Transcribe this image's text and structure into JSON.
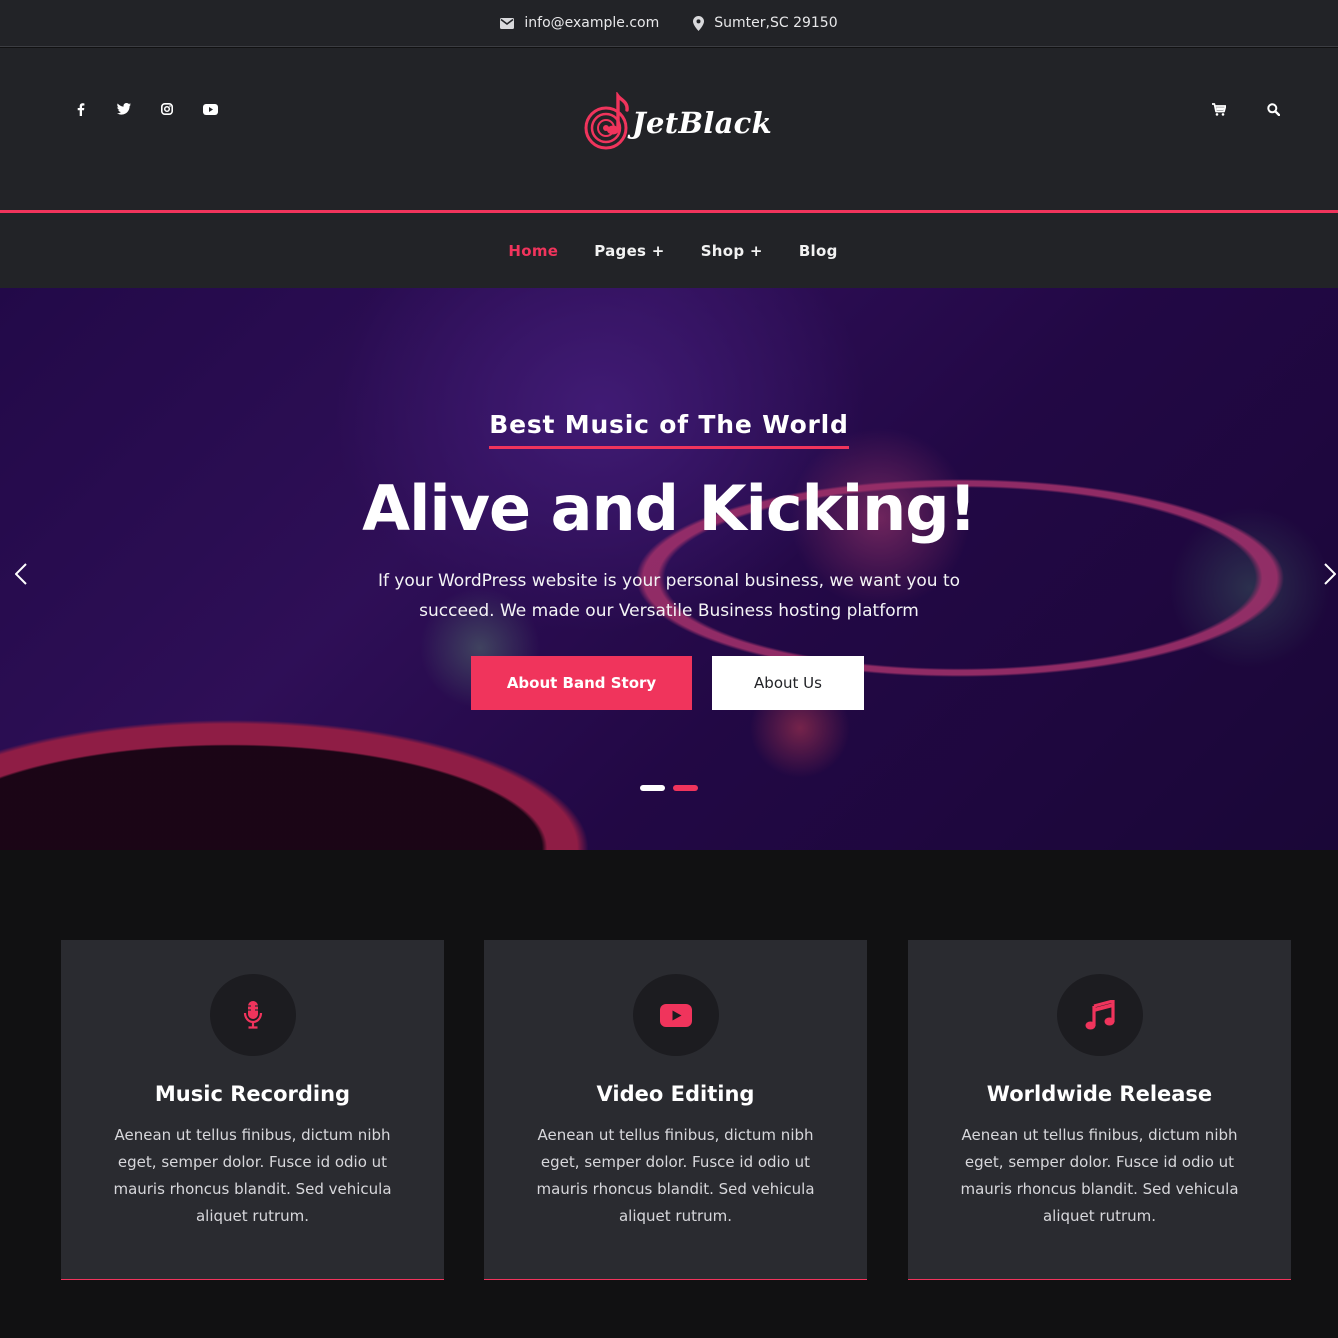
{
  "topbar": {
    "email": "info@example.com",
    "location": "Sumter,SC 29150"
  },
  "header": {
    "brand": "JetBlack",
    "social_icons": [
      "facebook-icon",
      "twitter-icon",
      "instagram-icon",
      "youtube-icon"
    ],
    "tool_icons": [
      "cart-icon",
      "search-icon"
    ]
  },
  "nav": {
    "items": [
      {
        "label": "Home",
        "active": true
      },
      {
        "label": "Pages +"
      },
      {
        "label": "Shop +"
      },
      {
        "label": "Blog"
      }
    ]
  },
  "hero": {
    "kicker": "Best Music of The World",
    "headline": "Alive and Kicking!",
    "subtext": "If your WordPress website is your personal business, we want you to succeed. We made our Versatile Business hosting platform",
    "primary_button": "About Band Story",
    "secondary_button": "About Us",
    "slides": 2,
    "active_slide": 1
  },
  "features": [
    {
      "icon": "microphone-icon",
      "title": "Music Recording",
      "text": "Aenean ut tellus finibus, dictum nibh eget, semper dolor. Fusce id odio ut mauris rhoncus blandit. Sed vehicula aliquet rutrum."
    },
    {
      "icon": "youtube-play-icon",
      "title": "Video Editing",
      "text": "Aenean ut tellus finibus, dictum nibh eget, semper dolor. Fusce id odio ut mauris rhoncus blandit. Sed vehicula aliquet rutrum."
    },
    {
      "icon": "music-note-icon",
      "title": "Worldwide Release",
      "text": "Aenean ut tellus finibus, dictum nibh eget, semper dolor. Fusce id odio ut mauris rhoncus blandit. Sed vehicula aliquet rutrum."
    }
  ],
  "colors": {
    "accent": "#f0345c",
    "header_bg": "#222327",
    "card_bg": "#2a2b30",
    "page_bg": "#111112"
  }
}
